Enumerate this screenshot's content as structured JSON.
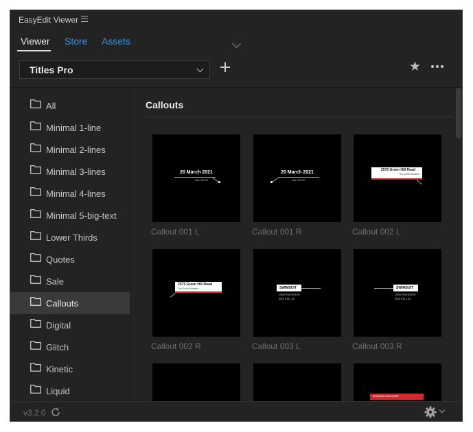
{
  "app": {
    "title": "EasyEdit Viewer"
  },
  "tabs": [
    {
      "label": "Viewer",
      "active": true
    },
    {
      "label": "Store",
      "active": false
    },
    {
      "label": "Assets",
      "active": false
    }
  ],
  "toolbar": {
    "pack_select": "Titles Pro"
  },
  "sidebar": {
    "items": [
      {
        "label": "All"
      },
      {
        "label": "Minimal 1-line"
      },
      {
        "label": "Minimal 2-lines"
      },
      {
        "label": "Minimal 3-lines"
      },
      {
        "label": "Minimal 4-lines"
      },
      {
        "label": "Minimal 5-big-text"
      },
      {
        "label": "Lower Thirds"
      },
      {
        "label": "Quotes"
      },
      {
        "label": "Sale"
      },
      {
        "label": "Callouts",
        "selected": true
      },
      {
        "label": "Digital"
      },
      {
        "label": "Glitch"
      },
      {
        "label": "Kinetic"
      },
      {
        "label": "Liquid"
      }
    ]
  },
  "content": {
    "section_title": "Callouts",
    "thumbs": [
      {
        "label": "Callout 001 L",
        "preview_title": "20 March 2021",
        "preview_sub": "start 20:00"
      },
      {
        "label": "Callout 001 R",
        "preview_title": "20 March 2021",
        "preview_sub": "start 20:00"
      },
      {
        "label": "Callout 002 L",
        "preview_title": "2575 Green Hill Road",
        "preview_sub": "The Smith Mansion"
      },
      {
        "label": "Callout 002 R",
        "preview_title": "2575 Green Hill Road",
        "preview_sub": "The Smith Mansion"
      },
      {
        "label": "Callout 003 L",
        "preview_title": "SWIMSUIT",
        "preview_sub": "100% POLYESTER",
        "preview_sub2": "SIZE S,M,L,XL"
      },
      {
        "label": "Callout 003 R",
        "preview_title": "SWIMSUIT",
        "preview_sub": "100% POLYESTER",
        "preview_sub2": "SIZE S,M,L,XL"
      },
      {
        "label": ""
      },
      {
        "label": ""
      },
      {
        "label": "",
        "preview_title": "BRANDED 2020 ASSET"
      }
    ]
  },
  "footer": {
    "version": "v3.2.0"
  },
  "colors": {
    "accent": "#3d8fd6",
    "panel": "#232323",
    "selected_row": "#3a3a3a",
    "thumb_bg": "#000000",
    "red": "#d12a2a"
  }
}
